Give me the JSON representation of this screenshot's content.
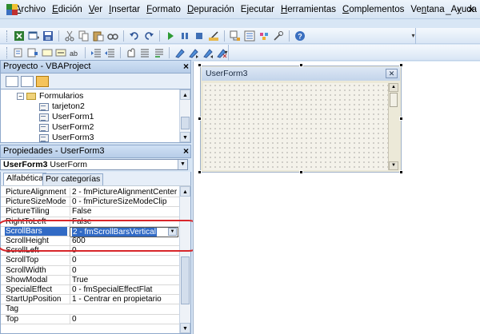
{
  "menu": {
    "items": [
      {
        "label": "Archivo",
        "hot": "A",
        "rest": "rchivo"
      },
      {
        "label": "Edición",
        "hot": "E",
        "rest": "dición"
      },
      {
        "label": "Ver",
        "hot": "V",
        "rest": "er"
      },
      {
        "label": "Insertar",
        "hot": "I",
        "rest": "nsertar"
      },
      {
        "label": "Formato",
        "hot": "F",
        "rest": "ormato"
      },
      {
        "label": "Depuración",
        "hot": "D",
        "rest": "epuración"
      },
      {
        "label": "Ejecutar",
        "hot": "j",
        "pre": "E",
        "rest": "ecutar"
      },
      {
        "label": "Herramientas",
        "hot": "H",
        "rest": "erramientas"
      },
      {
        "label": "Complementos",
        "hot": "C",
        "rest": "omplementos"
      },
      {
        "label": "Ventana",
        "hot": "n",
        "pre": "Ve",
        "rest": "tana"
      },
      {
        "label": "Ayuda",
        "hot": "y",
        "pre": "A",
        "rest": "uda"
      }
    ],
    "window_controls": [
      "_",
      "▫",
      "✕"
    ]
  },
  "toolbar_standard": [
    "excel-view-icon",
    "insert-userform-icon",
    "save-icon",
    "cut-icon",
    "copy-icon",
    "paste-icon",
    "find-icon",
    "undo-icon",
    "redo-icon",
    "run-icon",
    "break-icon",
    "reset-icon",
    "design-mode-icon",
    "project-explorer-icon",
    "properties-window-icon",
    "object-browser-icon",
    "toolbox-icon",
    "help-icon"
  ],
  "project_panel": {
    "title": "Proyecto - VBAProject",
    "close": "×",
    "folder_label": "Formularios",
    "items": [
      "tarjeton2",
      "UserForm1",
      "UserForm2",
      "UserForm3"
    ]
  },
  "properties_panel": {
    "title": "Propiedades - UserForm3",
    "close": "×",
    "object_name": "UserForm3",
    "object_type": "UserForm",
    "tabs": [
      "Alfabética",
      "Por categorías"
    ],
    "rows": [
      {
        "name": "PictureAlignment",
        "value": "2 - fmPictureAlignmentCenter"
      },
      {
        "name": "PictureSizeMode",
        "value": "0 - fmPictureSizeModeClip"
      },
      {
        "name": "PictureTiling",
        "value": "False"
      },
      {
        "name": "RightToLeft",
        "value": "False"
      },
      {
        "name": "ScrollBars",
        "value": "2 - fmScrollBarsVertical",
        "selected": true
      },
      {
        "name": "ScrollHeight",
        "value": "600"
      },
      {
        "name": "ScrollLeft",
        "value": "0"
      },
      {
        "name": "ScrollTop",
        "value": "0"
      },
      {
        "name": "ScrollWidth",
        "value": "0"
      },
      {
        "name": "ShowModal",
        "value": "True"
      },
      {
        "name": "SpecialEffect",
        "value": "0 - fmSpecialEffectFlat"
      },
      {
        "name": "StartUpPosition",
        "value": "1 - Centrar en propietario"
      },
      {
        "name": "Tag",
        "value": ""
      },
      {
        "name": "Top",
        "value": "0"
      }
    ]
  },
  "designer": {
    "form_title": "UserForm3",
    "form_close": "✕"
  },
  "colors": {
    "selection": "#316ac5",
    "highlight_ring": "#d8262a",
    "panel_title_bg": "#c3d7ef"
  }
}
